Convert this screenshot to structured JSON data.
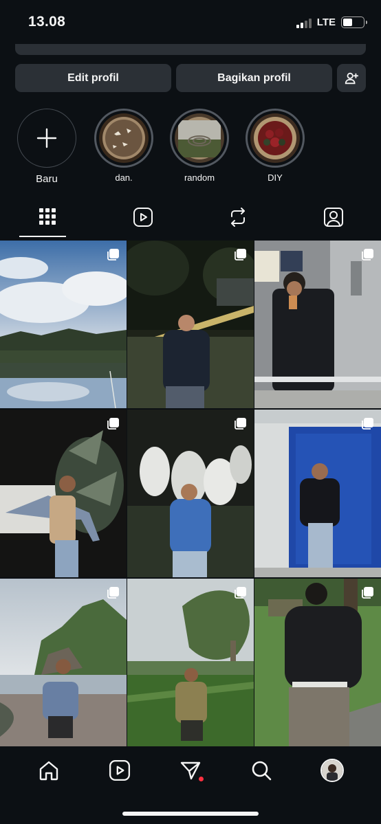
{
  "status_bar": {
    "time": "13.08",
    "network": "LTE",
    "battery_level": 0.45,
    "icons": [
      "signal-icon",
      "battery-icon"
    ]
  },
  "profile_actions": {
    "edit_label": "Edit profil",
    "share_label": "Bagikan profil",
    "add_person_icon": "add-person-icon"
  },
  "highlights": [
    {
      "label": "Baru",
      "icon": "plus-icon"
    },
    {
      "label": "dan."
    },
    {
      "label": "random"
    },
    {
      "label": "DIY"
    }
  ],
  "tabs": [
    {
      "icon": "grid-icon",
      "active": true
    },
    {
      "icon": "reels-icon",
      "active": false
    },
    {
      "icon": "reposts-icon",
      "active": false
    },
    {
      "icon": "tagged-icon",
      "active": false
    }
  ],
  "grid_posts": [
    {
      "multiple": true
    },
    {
      "multiple": true
    },
    {
      "multiple": true
    },
    {
      "multiple": true
    },
    {
      "multiple": true
    },
    {
      "multiple": true
    },
    {
      "multiple": true
    },
    {
      "multiple": true
    },
    {
      "multiple": true
    }
  ],
  "bottom_nav": [
    {
      "icon": "home-icon"
    },
    {
      "icon": "reels-icon"
    },
    {
      "icon": "messages-icon",
      "notification_dot": true
    },
    {
      "icon": "search-icon"
    },
    {
      "icon": "profile-avatar"
    }
  ],
  "colors": {
    "background": "#0c1014",
    "button": "#2b3036",
    "text": "#f5f5f5",
    "notification": "#ff3040"
  }
}
